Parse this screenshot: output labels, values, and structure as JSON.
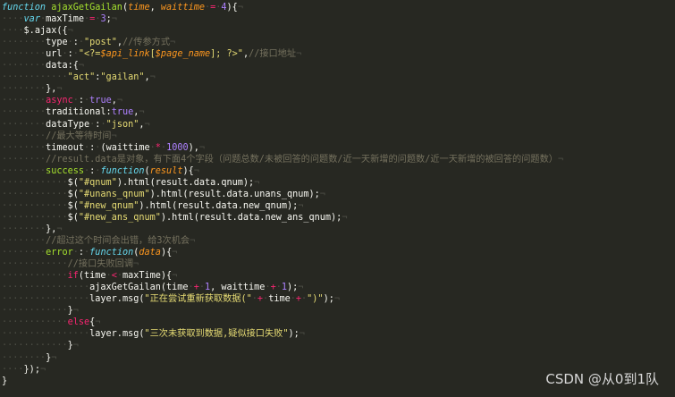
{
  "lines": [
    [
      [
        "kw",
        "function "
      ],
      [
        "fn",
        "ajaxGetGailan"
      ],
      [
        "punc",
        "("
      ],
      [
        "param",
        "time"
      ],
      [
        "punc",
        ", "
      ],
      [
        "param",
        "waittime"
      ],
      [
        "ws",
        "·"
      ],
      [
        "op",
        "="
      ],
      [
        "ws",
        "·"
      ],
      [
        "num",
        "4"
      ],
      [
        "punc",
        "){"
      ],
      [
        "ws",
        "¬"
      ]
    ],
    [
      [
        "ws",
        "····"
      ],
      [
        "kw",
        "var"
      ],
      [
        "ws",
        "·"
      ],
      [
        "plain",
        "maxTime"
      ],
      [
        "ws",
        "·"
      ],
      [
        "op",
        "="
      ],
      [
        "ws",
        "·"
      ],
      [
        "num",
        "3"
      ],
      [
        "punc",
        ";"
      ],
      [
        "ws",
        "¬"
      ]
    ],
    [
      [
        "ws",
        "····"
      ],
      [
        "plain",
        "$.ajax({"
      ],
      [
        "ws",
        "¬"
      ]
    ],
    [
      [
        "ws",
        "········"
      ],
      [
        "prop",
        "type"
      ],
      [
        "ws",
        "·"
      ],
      [
        "punc",
        ":"
      ],
      [
        "ws",
        "·"
      ],
      [
        "str",
        "\"post\""
      ],
      [
        "punc",
        ","
      ],
      [
        "cm",
        "//传参方式"
      ],
      [
        "ws",
        "¬"
      ]
    ],
    [
      [
        "ws",
        "········"
      ],
      [
        "prop",
        "url"
      ],
      [
        "ws",
        "·"
      ],
      [
        "punc",
        ":"
      ],
      [
        "ws",
        "·"
      ],
      [
        "str",
        "\"<?="
      ],
      [
        "param",
        "$api_link"
      ],
      [
        "str",
        "["
      ],
      [
        "param",
        "$page_name"
      ],
      [
        "str",
        "]; ?>\""
      ],
      [
        "punc",
        ","
      ],
      [
        "cm",
        "//接口地址"
      ],
      [
        "ws",
        "¬"
      ]
    ],
    [
      [
        "ws",
        "········"
      ],
      [
        "prop",
        "data"
      ],
      [
        "punc",
        ":{"
      ],
      [
        "ws",
        "¬"
      ]
    ],
    [
      [
        "ws",
        "············"
      ],
      [
        "str",
        "\"act\""
      ],
      [
        "punc",
        ":"
      ],
      [
        "str",
        "\"gailan\""
      ],
      [
        "punc",
        ","
      ],
      [
        "ws",
        "¬"
      ]
    ],
    [
      [
        "ws",
        "········"
      ],
      [
        "punc",
        "},"
      ],
      [
        "ws",
        "¬"
      ]
    ],
    [
      [
        "ws",
        "········"
      ],
      [
        "op",
        "async"
      ],
      [
        "ws",
        "·"
      ],
      [
        "punc",
        ":"
      ],
      [
        "ws",
        "·"
      ],
      [
        "bool",
        "true"
      ],
      [
        "punc",
        ","
      ],
      [
        "ws",
        "¬"
      ]
    ],
    [
      [
        "ws",
        "········"
      ],
      [
        "prop",
        "traditional"
      ],
      [
        "punc",
        ":"
      ],
      [
        "bool",
        "true"
      ],
      [
        "punc",
        ","
      ],
      [
        "ws",
        "¬"
      ]
    ],
    [
      [
        "ws",
        "········"
      ],
      [
        "prop",
        "dataType"
      ],
      [
        "ws",
        "·"
      ],
      [
        "punc",
        ":"
      ],
      [
        "ws",
        "·"
      ],
      [
        "str",
        "\"json\""
      ],
      [
        "punc",
        ","
      ],
      [
        "ws",
        "¬"
      ]
    ],
    [
      [
        "ws",
        "········"
      ],
      [
        "cm",
        "//最大等待时间"
      ],
      [
        "ws",
        "¬"
      ]
    ],
    [
      [
        "ws",
        "········"
      ],
      [
        "prop",
        "timeout"
      ],
      [
        "ws",
        "·"
      ],
      [
        "punc",
        ":"
      ],
      [
        "ws",
        "·"
      ],
      [
        "punc",
        "(waittime"
      ],
      [
        "ws",
        "·"
      ],
      [
        "op",
        "*"
      ],
      [
        "ws",
        "·"
      ],
      [
        "num",
        "1000"
      ],
      [
        "punc",
        "),"
      ],
      [
        "ws",
        "¬"
      ]
    ],
    [
      [
        "ws",
        "········"
      ],
      [
        "cm",
        "//result.data是对象，有下面4个字段（问题总数/未被回答的问题数/近一天新增的问题数/近一天新增的被回答的问题数）"
      ],
      [
        "ws",
        "¬"
      ]
    ],
    [
      [
        "ws",
        "········"
      ],
      [
        "fn",
        "success"
      ],
      [
        "ws",
        "·"
      ],
      [
        "punc",
        ":"
      ],
      [
        "ws",
        "·"
      ],
      [
        "kw",
        "function"
      ],
      [
        "punc",
        "("
      ],
      [
        "param",
        "result"
      ],
      [
        "punc",
        "){"
      ],
      [
        "ws",
        "¬"
      ]
    ],
    [
      [
        "ws",
        "············"
      ],
      [
        "plain",
        "$("
      ],
      [
        "str",
        "\"#qnum\""
      ],
      [
        "plain",
        ").html(result.data.qnum);"
      ],
      [
        "ws",
        "¬"
      ]
    ],
    [
      [
        "ws",
        "············"
      ],
      [
        "plain",
        "$("
      ],
      [
        "str",
        "\"#unans_qnum\""
      ],
      [
        "plain",
        ").html(result.data.unans_qnum);"
      ],
      [
        "ws",
        "¬"
      ]
    ],
    [
      [
        "ws",
        "············"
      ],
      [
        "plain",
        "$("
      ],
      [
        "str",
        "\"#new_qnum\""
      ],
      [
        "plain",
        ").html(result.data.new_qnum);"
      ],
      [
        "ws",
        "¬"
      ]
    ],
    [
      [
        "ws",
        "············"
      ],
      [
        "plain",
        "$("
      ],
      [
        "str",
        "\"#new_ans_qnum\""
      ],
      [
        "plain",
        ").html(result.data.new_ans_qnum);"
      ],
      [
        "ws",
        "¬"
      ]
    ],
    [
      [
        "ws",
        "········"
      ],
      [
        "punc",
        "},"
      ],
      [
        "ws",
        "¬"
      ]
    ],
    [
      [
        "ws",
        "········"
      ],
      [
        "cm",
        "//超过这个时间会出错，给3次机会"
      ],
      [
        "ws",
        "¬"
      ]
    ],
    [
      [
        "ws",
        "········"
      ],
      [
        "fn",
        "error"
      ],
      [
        "ws",
        "·"
      ],
      [
        "punc",
        ":"
      ],
      [
        "ws",
        "·"
      ],
      [
        "kw",
        "function"
      ],
      [
        "punc",
        "("
      ],
      [
        "param",
        "data"
      ],
      [
        "punc",
        "){"
      ],
      [
        "ws",
        "¬"
      ]
    ],
    [
      [
        "ws",
        "············"
      ],
      [
        "cm",
        "//接口失败回调"
      ],
      [
        "ws",
        "¬"
      ]
    ],
    [
      [
        "ws",
        "············"
      ],
      [
        "op",
        "if"
      ],
      [
        "punc",
        "(time"
      ],
      [
        "ws",
        "·"
      ],
      [
        "op",
        "<"
      ],
      [
        "ws",
        "·"
      ],
      [
        "plain",
        "maxTime){"
      ],
      [
        "ws",
        "¬"
      ]
    ],
    [
      [
        "ws",
        "················"
      ],
      [
        "plain",
        "ajaxGetGailan(time"
      ],
      [
        "ws",
        "·"
      ],
      [
        "op",
        "+"
      ],
      [
        "ws",
        "·"
      ],
      [
        "num",
        "1"
      ],
      [
        "punc",
        ", waittime"
      ],
      [
        "ws",
        "·"
      ],
      [
        "op",
        "+"
      ],
      [
        "ws",
        "·"
      ],
      [
        "num",
        "1"
      ],
      [
        "punc",
        ");"
      ],
      [
        "ws",
        "¬"
      ]
    ],
    [
      [
        "ws",
        "················"
      ],
      [
        "plain",
        "layer.msg("
      ],
      [
        "str",
        "\"正在尝试重新获取数据(\""
      ],
      [
        "ws",
        "·"
      ],
      [
        "op",
        "+"
      ],
      [
        "ws",
        "·"
      ],
      [
        "plain",
        "time"
      ],
      [
        "ws",
        "·"
      ],
      [
        "op",
        "+"
      ],
      [
        "ws",
        "·"
      ],
      [
        "str",
        "\")\""
      ],
      [
        "punc",
        ");"
      ],
      [
        "ws",
        "¬"
      ]
    ],
    [
      [
        "ws",
        "············"
      ],
      [
        "punc",
        "}"
      ],
      [
        "ws",
        "¬"
      ]
    ],
    [
      [
        "ws",
        "············"
      ],
      [
        "op",
        "else"
      ],
      [
        "punc",
        "{"
      ],
      [
        "ws",
        "¬"
      ]
    ],
    [
      [
        "ws",
        "················"
      ],
      [
        "plain",
        "layer.msg("
      ],
      [
        "str",
        "\"三次未获取到数据,疑似接口失败\""
      ],
      [
        "punc",
        ");"
      ],
      [
        "ws",
        "¬"
      ]
    ],
    [
      [
        "ws",
        "············"
      ],
      [
        "punc",
        "}"
      ],
      [
        "ws",
        "¬"
      ]
    ],
    [
      [
        "ws",
        "········"
      ],
      [
        "punc",
        "}"
      ],
      [
        "ws",
        "¬"
      ]
    ],
    [
      [
        "ws",
        "····"
      ],
      [
        "punc",
        "});"
      ],
      [
        "ws",
        "¬"
      ]
    ],
    [
      [
        "punc",
        "}"
      ]
    ]
  ],
  "watermark": "CSDN @从0到1队"
}
